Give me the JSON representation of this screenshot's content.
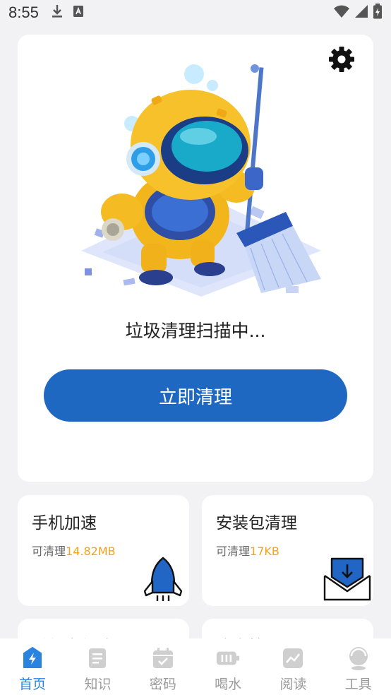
{
  "status_bar": {
    "time": "8:55",
    "icons": [
      "download-icon",
      "keyboard-a-icon",
      "wifi-icon",
      "signal-icon",
      "battery-charging-icon"
    ]
  },
  "main": {
    "scan_status": "垃圾清理扫描中...",
    "clean_button": "立即清理",
    "settings_icon": "gear-icon",
    "accent": "#1f68c2"
  },
  "features": [
    {
      "title": "手机加速",
      "sub_prefix": "可清理",
      "sub_amount": "14.82MB",
      "icon": "rocket-icon"
    },
    {
      "title": "安装包清理",
      "sub_prefix": "可清理",
      "sub_amount": "17KB",
      "icon": "download-tray-icon"
    },
    {
      "title": "重复文件垃圾",
      "icon": ""
    },
    {
      "title": "病毒检测",
      "icon": ""
    }
  ],
  "nav": {
    "active_color": "#2b83e0",
    "items": [
      {
        "label": "首页",
        "icon": "lightning-home-icon",
        "active": true
      },
      {
        "label": "知识",
        "icon": "document-icon",
        "active": false
      },
      {
        "label": "密码",
        "icon": "calendar-check-icon",
        "active": false
      },
      {
        "label": "喝水",
        "icon": "battery-cup-icon",
        "active": false
      },
      {
        "label": "阅读",
        "icon": "trend-chart-icon",
        "active": false
      },
      {
        "label": "工具",
        "icon": "headset-icon",
        "active": false
      }
    ]
  }
}
